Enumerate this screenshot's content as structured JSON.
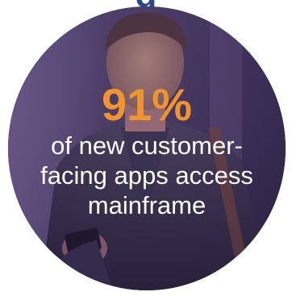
{
  "heading_fragment": "g",
  "stat": {
    "value": "91%",
    "caption_lines": [
      "of new customer-",
      "facing apps access",
      "mainframe"
    ]
  },
  "colors": {
    "heading": "#2b4a8c",
    "stat": "#f0952e",
    "caption": "#ffffff"
  }
}
